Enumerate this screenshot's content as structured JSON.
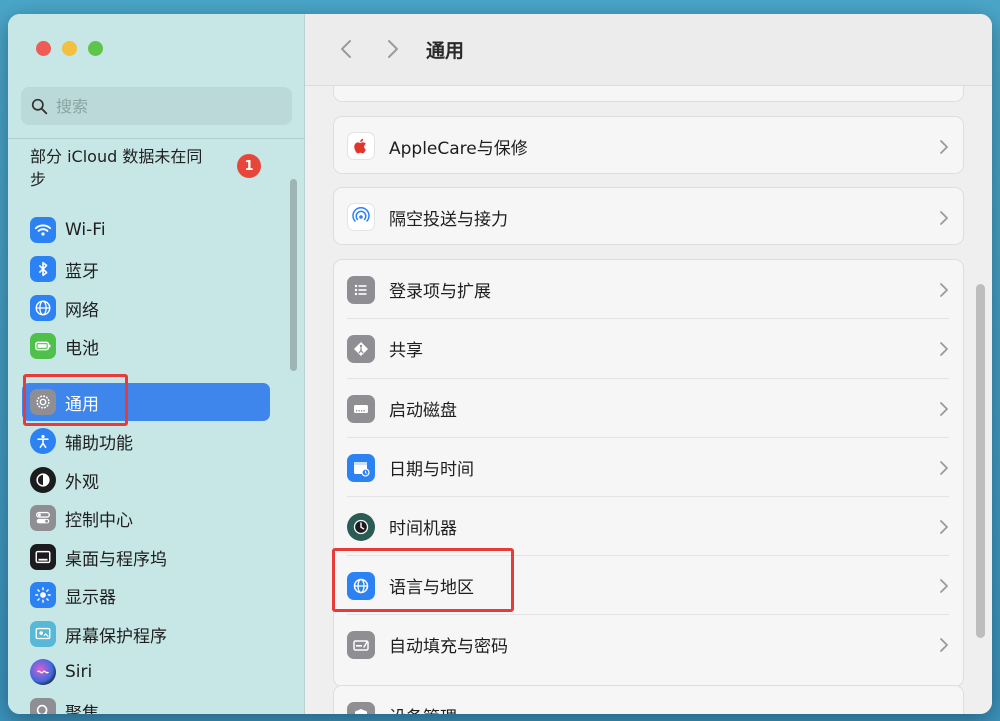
{
  "window": {
    "title": "通用"
  },
  "sidebar": {
    "search_placeholder": "搜索",
    "sync_notice": "部分 iCloud 数据未在同步",
    "sync_badge": "1",
    "items": [
      {
        "label": "Wi-Fi",
        "icon": "wifi-icon",
        "color": "#2d82f3"
      },
      {
        "label": "蓝牙",
        "icon": "bluetooth-icon",
        "color": "#2d82f3"
      },
      {
        "label": "网络",
        "icon": "globe-icon",
        "color": "#2d82f3"
      },
      {
        "label": "电池",
        "icon": "battery-icon",
        "color": "#4fc14a"
      },
      {
        "label": "通用",
        "icon": "gear-icon",
        "color": "#8e8e93",
        "selected": true
      },
      {
        "label": "辅助功能",
        "icon": "accessibility-icon",
        "color": "#2d82f3"
      },
      {
        "label": "外观",
        "icon": "appearance-icon",
        "color": "#1c1c1e"
      },
      {
        "label": "控制中心",
        "icon": "control-center-icon",
        "color": "#8e8e93"
      },
      {
        "label": "桌面与程序坞",
        "icon": "dock-icon",
        "color": "#1c1c1e"
      },
      {
        "label": "显示器",
        "icon": "display-icon",
        "color": "#2d82f3"
      },
      {
        "label": "屏幕保护程序",
        "icon": "screensaver-icon",
        "color": "#58b8d8"
      },
      {
        "label": "Siri",
        "icon": "siri-icon",
        "color": "#3a3a3c"
      },
      {
        "label": "聚焦",
        "icon": "spotlight-icon",
        "color": "#8e8e93"
      }
    ]
  },
  "main": {
    "rows": [
      {
        "label": "AppleCare与保修",
        "icon": "apple-icon"
      },
      {
        "label": "隔空投送与接力",
        "icon": "airdrop-icon"
      },
      {
        "label": "登录项与扩展",
        "icon": "list-icon"
      },
      {
        "label": "共享",
        "icon": "sharing-icon"
      },
      {
        "label": "启动磁盘",
        "icon": "disk-icon"
      },
      {
        "label": "日期与时间",
        "icon": "calendar-icon"
      },
      {
        "label": "时间机器",
        "icon": "time-machine-icon"
      },
      {
        "label": "语言与地区",
        "icon": "language-globe-icon"
      },
      {
        "label": "自动填充与密码",
        "icon": "autofill-icon"
      },
      {
        "label": "设备管理",
        "icon": "device-management-icon"
      }
    ]
  },
  "colors": {
    "accent": "#3e85ec",
    "highlight": "#e93a3a",
    "sidebar_bg": "#c7e6e6"
  }
}
